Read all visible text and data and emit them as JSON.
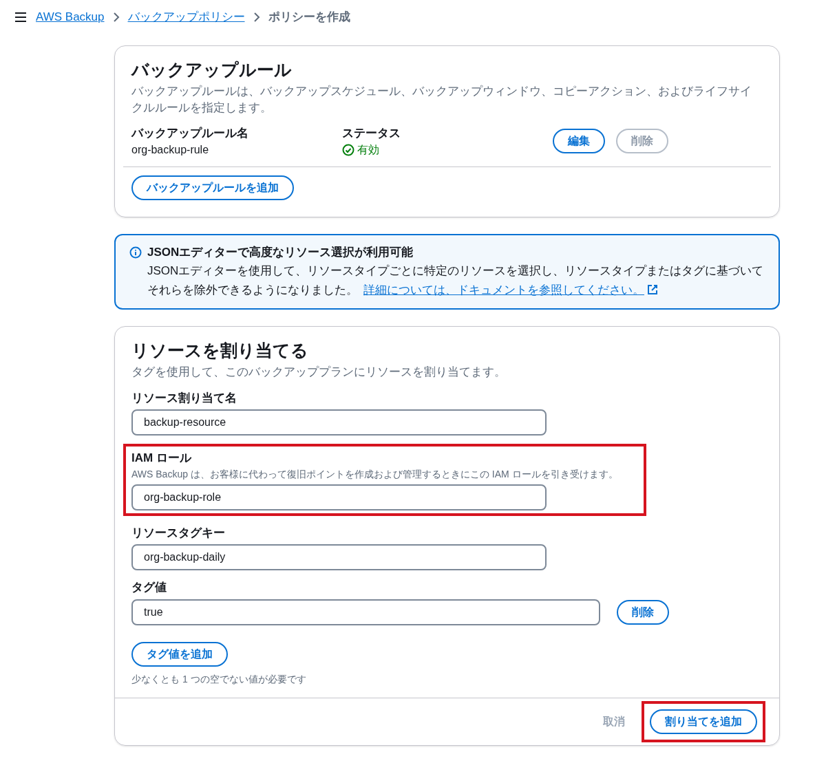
{
  "breadcrumb": [
    {
      "label": "AWS Backup",
      "link": true
    },
    {
      "label": "バックアップポリシー",
      "link": true
    },
    {
      "label": "ポリシーを作成",
      "link": false
    }
  ],
  "rules_card": {
    "title": "バックアップルール",
    "description": "バックアップルールは、バックアップスケジュール、バックアップウィンドウ、コピーアクション、およびライフサイクルルールを指定します。",
    "rule": {
      "name_label": "バックアップルール名",
      "name": "org-backup-rule",
      "status_label": "ステータス",
      "status": "有効",
      "status_ok": true,
      "buttons": [
        {
          "label": "編集",
          "disabled": false
        },
        {
          "label": "削除",
          "disabled": true
        }
      ]
    },
    "add_button": "バックアップルールを追加"
  },
  "info_alert": {
    "title": "JSONエディターで高度なリソース選択が利用可能",
    "text": "JSONエディターを使用して、リソースタイプごとに特定のリソースを選択し、リソースタイプまたはタグに基づいてそれらを除外できるようになりました。",
    "link": "詳細については、ドキュメントを参照してください。"
  },
  "assign_card": {
    "title": "リソースを割り当てる",
    "description": "タグを使用して、このバックアッププランにリソースを割り当てます。",
    "fields": [
      {
        "label": "リソース割り当て名",
        "value": "backup-resource",
        "highlighted": false
      },
      {
        "label": "IAM ロール",
        "description": "AWS Backup は、お客様に代わって復旧ポイントを作成および管理するときにこの IAM ロールを引き受けます。",
        "value": "org-backup-role",
        "highlighted": true
      },
      {
        "label": "リソースタグキー",
        "value": "org-backup-daily",
        "highlighted": false
      },
      {
        "label": "タグ値",
        "value": "true",
        "highlighted": false,
        "remove_button": "削除"
      }
    ],
    "add_tag_button": "タグ値を追加",
    "hint": "少なくとも 1 つの空でない値が必要です",
    "footer": [
      {
        "label": "取消",
        "kind": "link",
        "disabled": true,
        "highlighted": false
      },
      {
        "label": "割り当てを追加",
        "kind": "button",
        "disabled": false,
        "highlighted": true
      }
    ]
  }
}
